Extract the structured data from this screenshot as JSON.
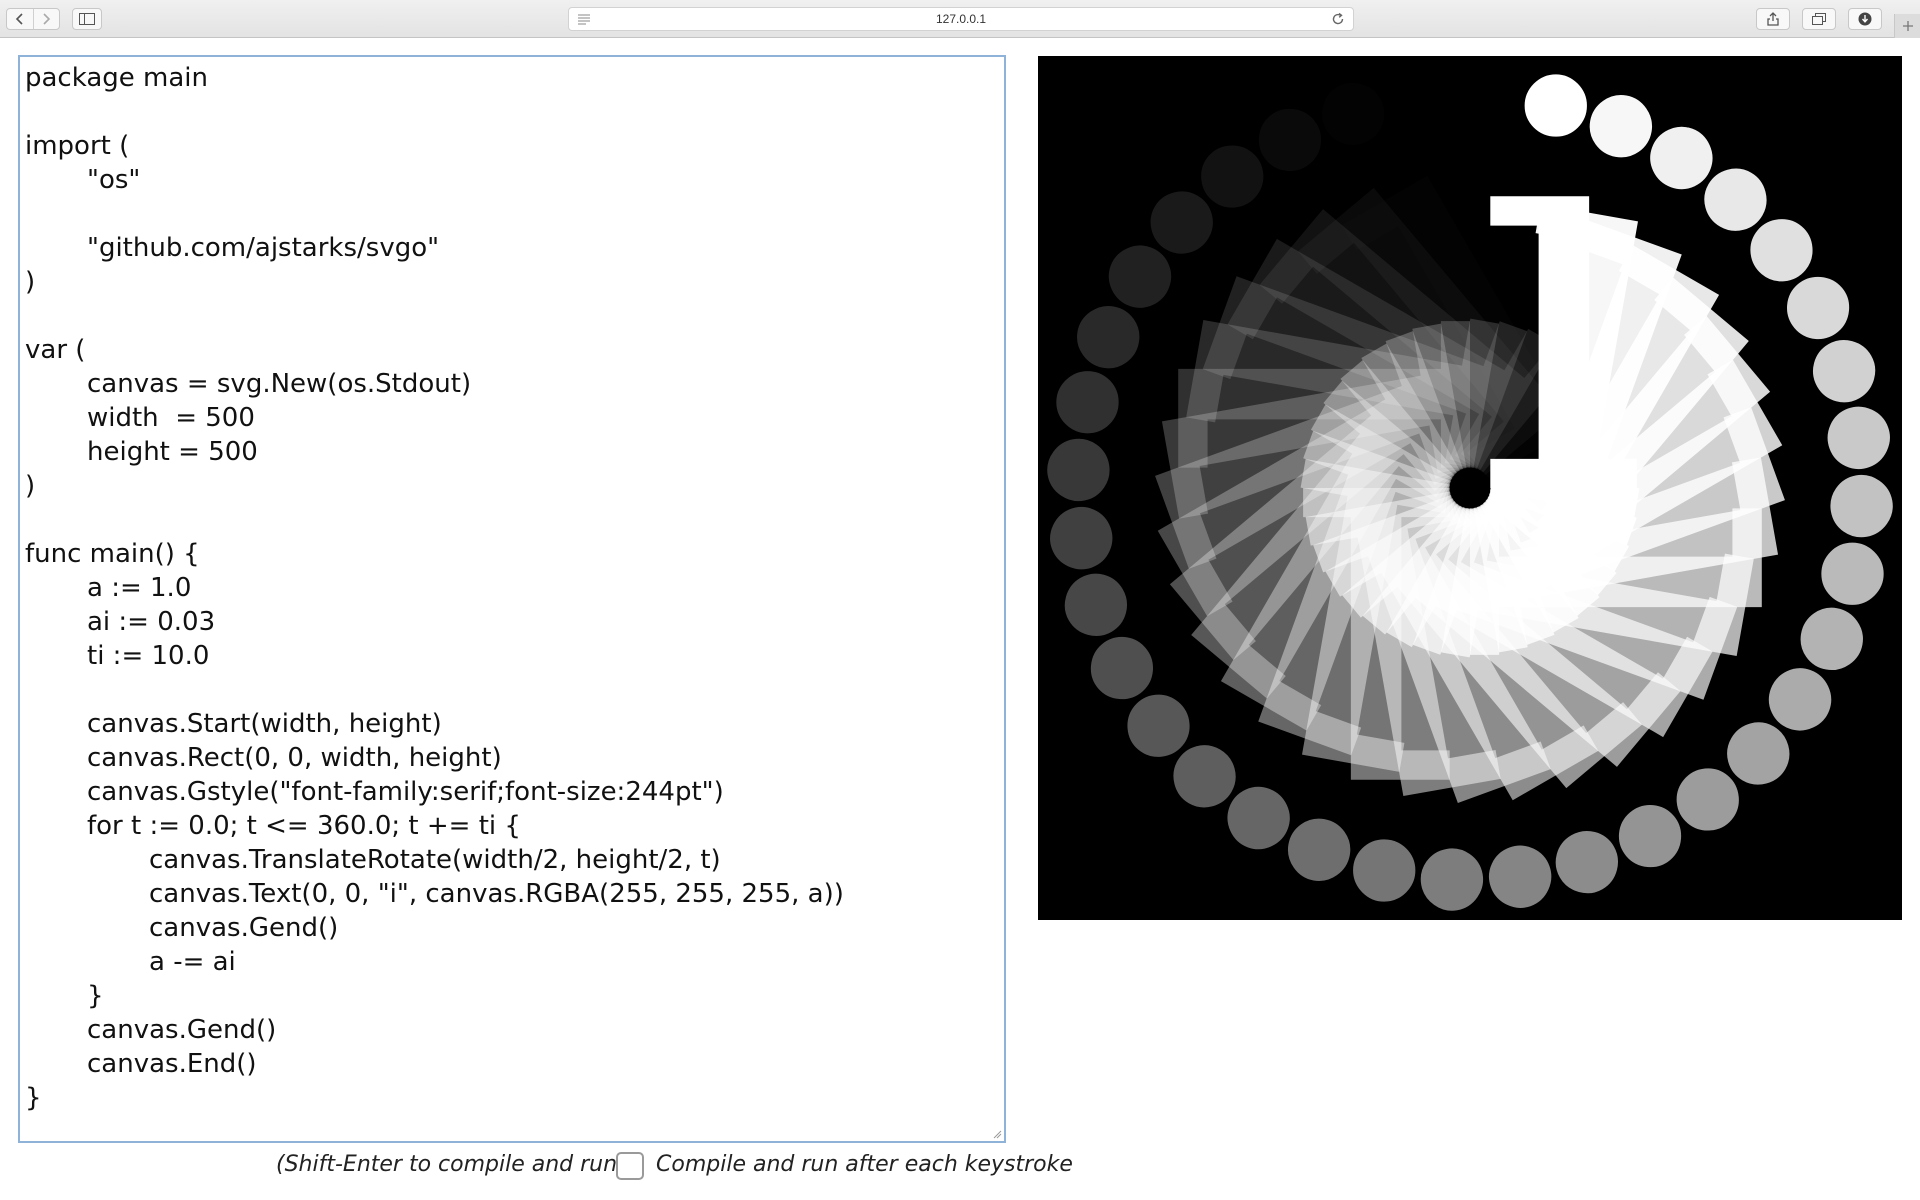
{
  "browser": {
    "url": "127.0.0.1"
  },
  "editor": {
    "lines": [
      {
        "indent": 0,
        "text": "package main"
      },
      {
        "indent": 0,
        "text": ""
      },
      {
        "indent": 0,
        "text": "import ("
      },
      {
        "indent": 1,
        "text": "\"os\""
      },
      {
        "indent": 0,
        "text": ""
      },
      {
        "indent": 1,
        "text": "\"github.com/ajstarks/svgo\""
      },
      {
        "indent": 0,
        "text": ")"
      },
      {
        "indent": 0,
        "text": ""
      },
      {
        "indent": 0,
        "text": "var ("
      },
      {
        "indent": 1,
        "text": "canvas = svg.New(os.Stdout)"
      },
      {
        "indent": 1,
        "text": "width  = 500"
      },
      {
        "indent": 1,
        "text": "height = 500"
      },
      {
        "indent": 0,
        "text": ")"
      },
      {
        "indent": 0,
        "text": ""
      },
      {
        "indent": 0,
        "text": "func main() {"
      },
      {
        "indent": 1,
        "text": "a := 1.0"
      },
      {
        "indent": 1,
        "text": "ai := 0.03"
      },
      {
        "indent": 1,
        "text": "ti := 10.0"
      },
      {
        "indent": 0,
        "text": ""
      },
      {
        "indent": 1,
        "text": "canvas.Start(width, height)"
      },
      {
        "indent": 1,
        "text": "canvas.Rect(0, 0, width, height)"
      },
      {
        "indent": 1,
        "text": "canvas.Gstyle(\"font-family:serif;font-size:244pt\")"
      },
      {
        "indent": 1,
        "text": "for t := 0.0; t <= 360.0; t += ti {"
      },
      {
        "indent": 2,
        "text": "canvas.TranslateRotate(width/2, height/2, t)"
      },
      {
        "indent": 2,
        "text": "canvas.Text(0, 0, \"i\", canvas.RGBA(255, 255, 255, a))"
      },
      {
        "indent": 2,
        "text": "canvas.Gend()"
      },
      {
        "indent": 2,
        "text": "a -= ai"
      },
      {
        "indent": 1,
        "text": "}"
      },
      {
        "indent": 1,
        "text": "canvas.Gend()"
      },
      {
        "indent": 1,
        "text": "canvas.End()"
      },
      {
        "indent": 0,
        "text": "}"
      }
    ]
  },
  "footer": {
    "hint": "(Shift-Enter to compile and run.)",
    "checkbox_label": "Compile and run after each keystroke",
    "checkbox_checked": false
  },
  "output": {
    "background": "#000000",
    "glyph": "i",
    "glyph_color": "#ffffff",
    "start_alpha": 1.0,
    "alpha_step": 0.03,
    "angle_step": 10.0,
    "angle_max": 360.0
  }
}
